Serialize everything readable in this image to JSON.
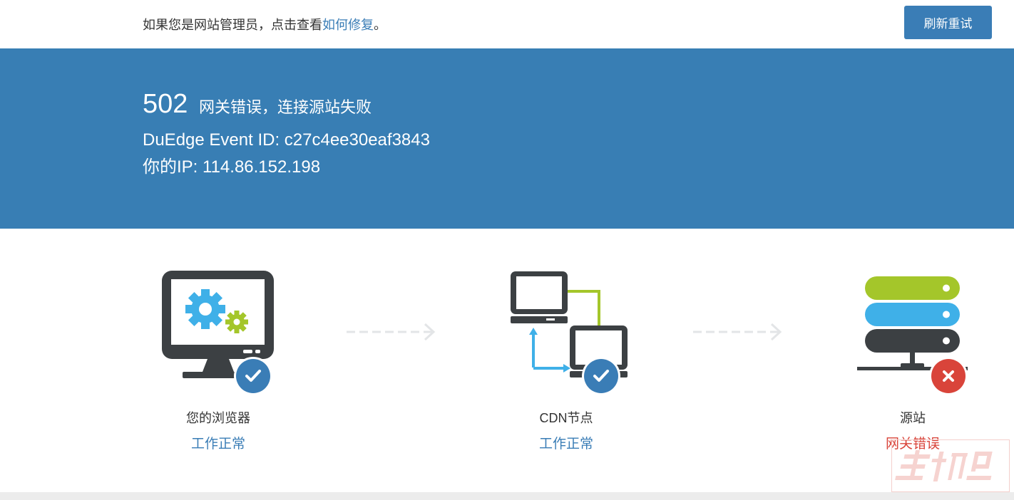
{
  "top_bar": {
    "notice_prefix": "如果您是网站管理员，点击查看",
    "notice_link": "如何修复",
    "notice_suffix": "。",
    "retry_button": "刷新重试"
  },
  "banner": {
    "error_code": "502",
    "error_message": "网关错误，连接源站失败",
    "event_id_line": "DuEdge Event ID: c27c4ee30eaf3843",
    "ip_line": "你的IP: 114.86.152.198"
  },
  "nodes": [
    {
      "label": "您的浏览器",
      "status": "工作正常",
      "state": "ok",
      "icon": "monitor-gears-icon"
    },
    {
      "label": "CDN节点",
      "status": "工作正常",
      "state": "ok",
      "icon": "cdn-network-icon"
    },
    {
      "label": "源站",
      "status": "网关错误",
      "state": "error",
      "icon": "server-stack-icon"
    }
  ],
  "colors": {
    "brand_blue": "#387eb4",
    "ok_blue": "#3a7db6",
    "error_red": "#d9443a",
    "dark_gray": "#3c4043",
    "gear_blue": "#3fb0e8",
    "lime_green": "#a4c62a"
  }
}
